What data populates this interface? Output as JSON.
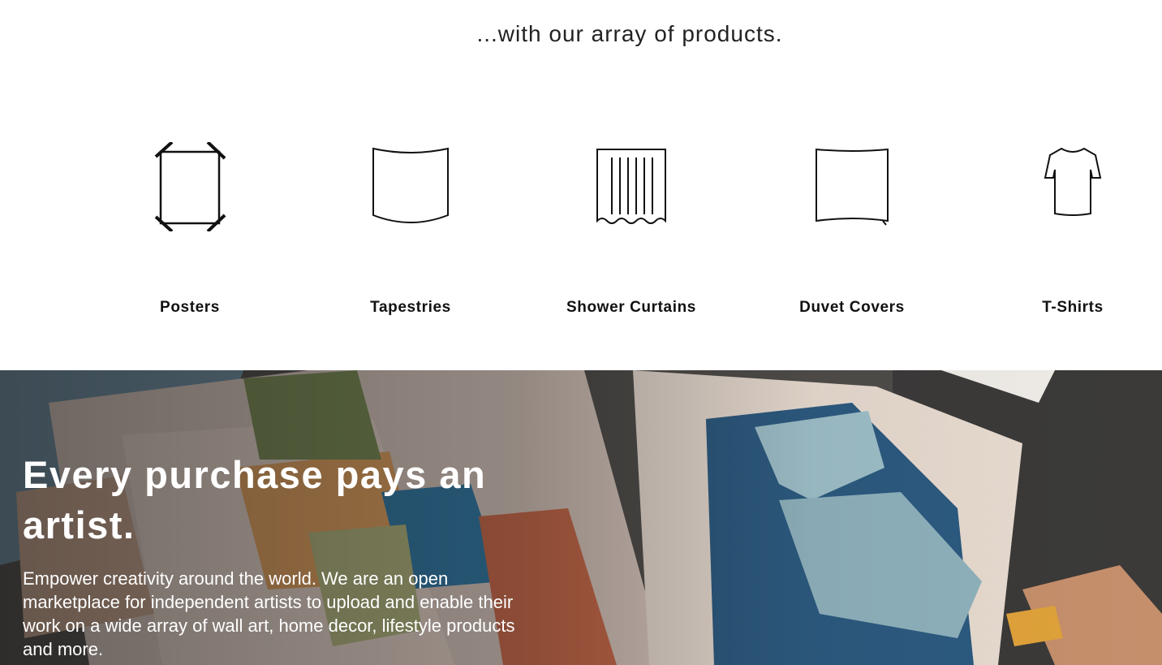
{
  "intro": {
    "text": "...with our array of products."
  },
  "products": [
    {
      "label": "Posters",
      "icon": "poster-icon"
    },
    {
      "label": "Tapestries",
      "icon": "tapestry-icon"
    },
    {
      "label": "Shower Curtains",
      "icon": "shower-curtain-icon"
    },
    {
      "label": "Duvet Covers",
      "icon": "duvet-cover-icon"
    },
    {
      "label": "T-Shirts",
      "icon": "tshirt-icon"
    }
  ],
  "hero": {
    "title": "Every purchase pays an artist.",
    "body": "Empower creativity around the world. We are an open marketplace for independent artists to upload and enable their work on a wide array of wall art, home decor, lifestyle products and more."
  },
  "colors": {
    "text": "#111111",
    "background": "#ffffff",
    "hero_text": "#ffffff"
  }
}
